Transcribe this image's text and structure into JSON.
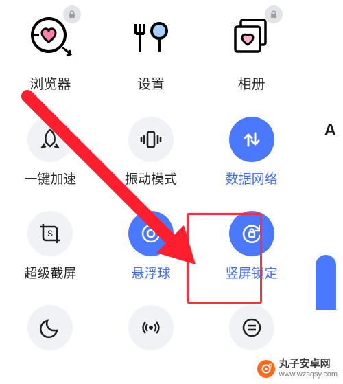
{
  "apps": [
    {
      "id": "browser",
      "label": "浏览器",
      "icon": "heart-target-icon",
      "locked": true
    },
    {
      "id": "settings",
      "label": "设置",
      "icon": "cutlery-icon",
      "locked": false
    },
    {
      "id": "gallery",
      "label": "相册",
      "icon": "photo-stack-icon",
      "locked": true
    }
  ],
  "quick_settings": {
    "rows": [
      [
        {
          "id": "one_tap_boost",
          "label": "一键加速",
          "icon": "rocket-icon",
          "active": false
        },
        {
          "id": "vibration_mode",
          "label": "振动模式",
          "icon": "vibrate-icon",
          "active": false
        },
        {
          "id": "mobile_data",
          "label": "数据网络",
          "icon": "data-arrows-icon",
          "active": true
        }
      ],
      [
        {
          "id": "super_screenshot",
          "label": "超级截屏",
          "icon": "crop-s-icon",
          "active": false
        },
        {
          "id": "float_ball",
          "label": "悬浮球",
          "icon": "target-circle-icon",
          "active": true
        },
        {
          "id": "orientation_lock",
          "label": "竖屏锁定",
          "icon": "rotation-lock-icon",
          "active": true
        }
      ],
      [
        {
          "id": "night_mode",
          "label": "",
          "icon": "moon-icon",
          "active": false
        },
        {
          "id": "hotspot",
          "label": "",
          "icon": "broadcast-icon",
          "active": false
        },
        {
          "id": "more",
          "label": "",
          "icon": "menu-lines-icon",
          "active": false
        }
      ]
    ]
  },
  "font_indicator": "A",
  "annotation": {
    "arrow_color": "#ff1e2d",
    "highlight_target": "orientation_lock"
  },
  "watermark": {
    "name": "丸子安卓网",
    "url": "www.wzsqsy.com"
  }
}
